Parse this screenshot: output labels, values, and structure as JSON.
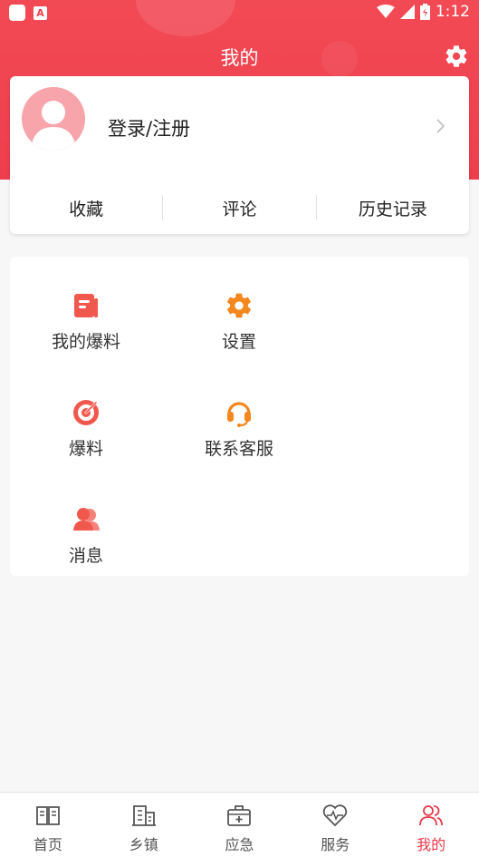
{
  "status_bar": {
    "time": "1:12",
    "app_badge": "A"
  },
  "header": {
    "title": "我的"
  },
  "profile": {
    "login_label": "登录/注册"
  },
  "profile_stats": [
    {
      "label": "收藏"
    },
    {
      "label": "评论"
    },
    {
      "label": "历史记录"
    }
  ],
  "menu": [
    {
      "label": "我的爆料",
      "icon": "document-icon"
    },
    {
      "label": "设置",
      "icon": "gear-icon"
    },
    {
      "label": "爆料",
      "icon": "target-icon"
    },
    {
      "label": "联系客服",
      "icon": "headset-icon"
    },
    {
      "label": "消息",
      "icon": "users-icon"
    }
  ],
  "tabbar": [
    {
      "label": "首页",
      "icon": "book-icon"
    },
    {
      "label": "乡镇",
      "icon": "building-icon"
    },
    {
      "label": "应急",
      "icon": "first-aid-kit-icon"
    },
    {
      "label": "服务",
      "icon": "heart-pulse-icon"
    },
    {
      "label": "我的",
      "icon": "users-icon",
      "active": true
    }
  ],
  "colors": {
    "brand": "#ee3e4d",
    "menu_icon_red": "#f0584e",
    "menu_icon_orange": "#f5871f",
    "tab_active": "#e8394a"
  }
}
